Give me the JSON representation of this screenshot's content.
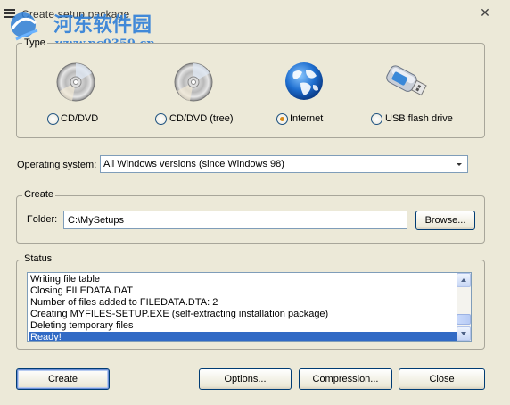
{
  "window": {
    "title": "Create setup package",
    "watermark_text": "河东软件园",
    "watermark_url": "www.pc0359.cn"
  },
  "type_group": {
    "label": "Type",
    "options": [
      {
        "label": "CD/DVD",
        "icon": "cd-dvd-icon",
        "checked": false
      },
      {
        "label": "CD/DVD (tree)",
        "icon": "cd-dvd-tree-icon",
        "checked": false
      },
      {
        "label": "Internet",
        "icon": "globe-icon",
        "checked": true
      },
      {
        "label": "USB flash drive",
        "icon": "usb-drive-icon",
        "checked": false
      }
    ]
  },
  "os": {
    "label": "Operating system:",
    "value": "All Windows versions (since Windows 98)"
  },
  "create_group": {
    "label": "Create",
    "folder_label": "Folder:",
    "folder_value": "C:\\MySetups",
    "browse_label": "Browse..."
  },
  "status_group": {
    "label": "Status",
    "lines": [
      "Writing file table",
      "Closing FILEDATA.DAT",
      "Number of files added to FILEDATA.DTA: 2",
      "Creating MYFILES-SETUP.EXE (self-extracting installation package)",
      "Deleting temporary files",
      "Ready!"
    ]
  },
  "buttons": {
    "create": "Create",
    "options": "Options...",
    "compression": "Compression...",
    "close": "Close"
  },
  "colors": {
    "background": "#ece9d8",
    "selection": "#316ac5",
    "radio_checked": "#d98a18",
    "watermark": "#2f7fd8"
  }
}
